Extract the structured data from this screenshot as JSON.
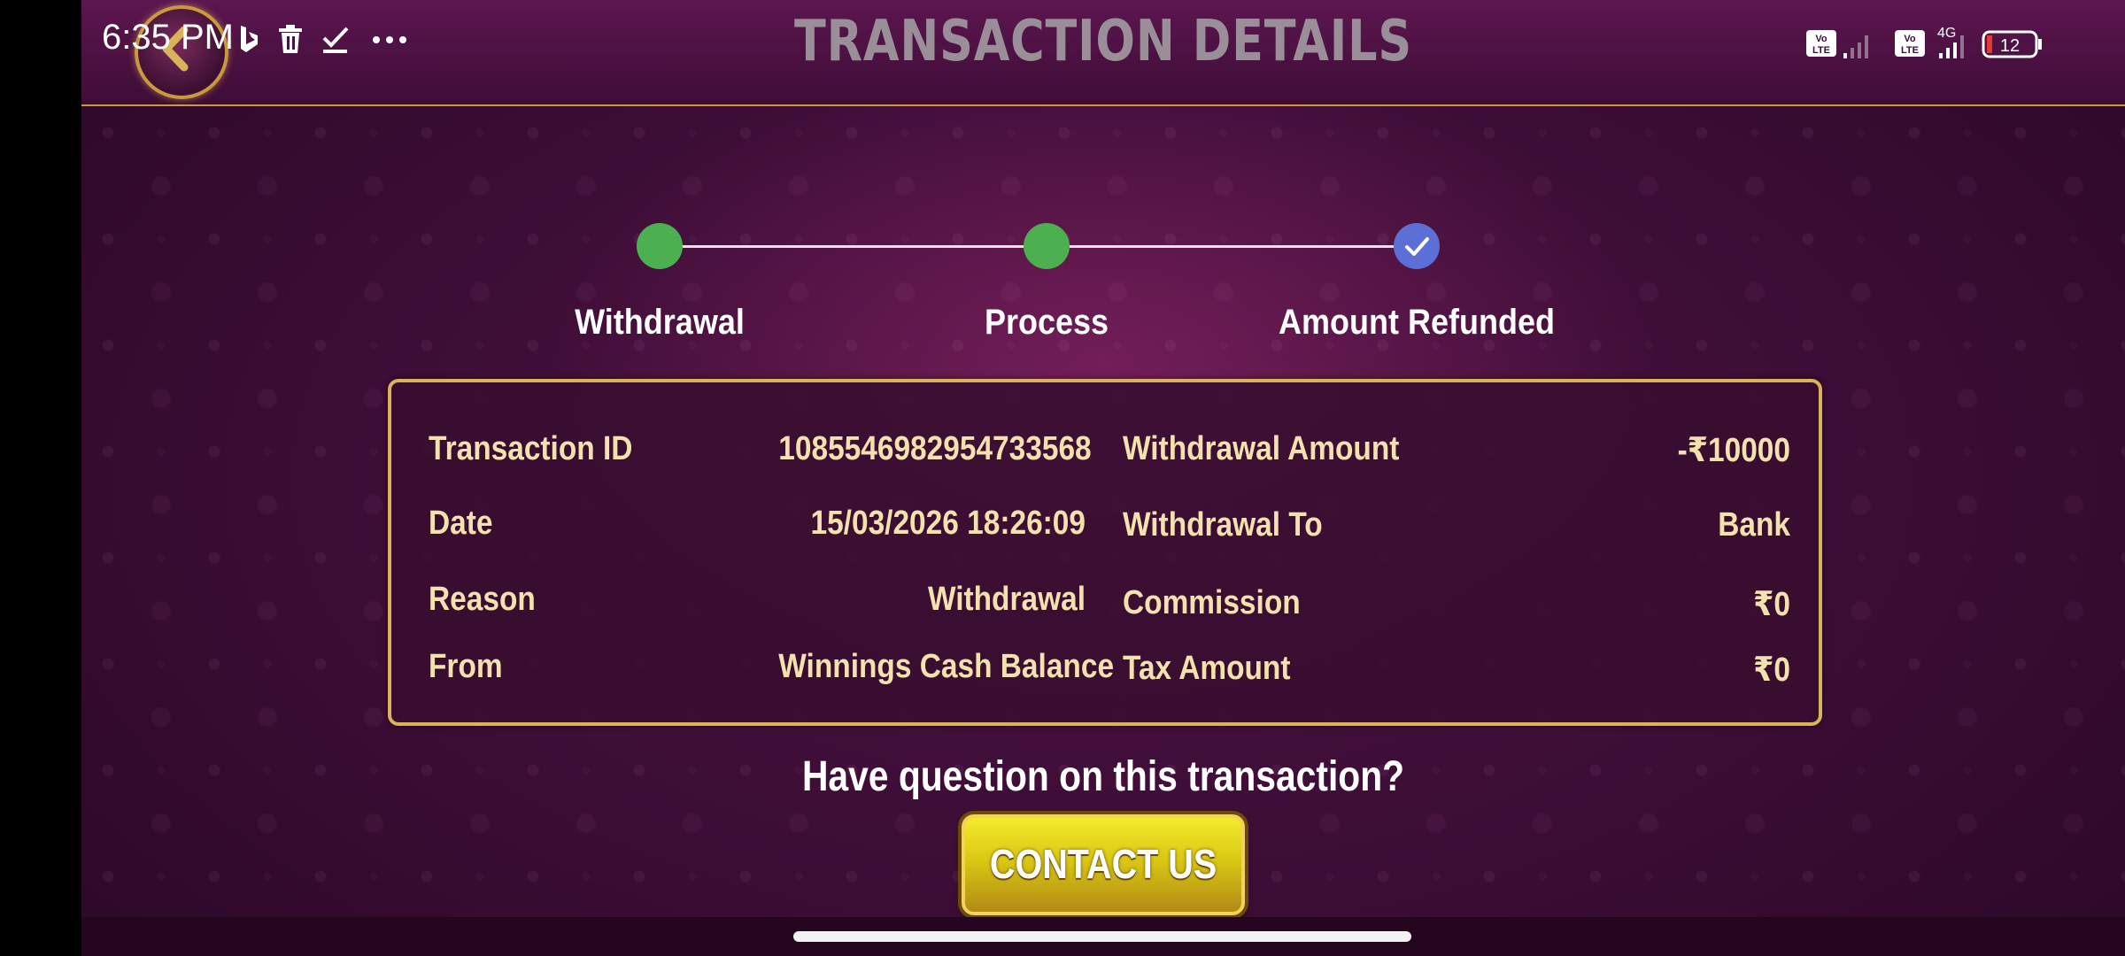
{
  "status_bar": {
    "time": "6:35 PM",
    "left_icons": [
      "bing-icon",
      "trash-icon",
      "check-icon",
      "more-icon"
    ],
    "network": "4G",
    "battery": "12"
  },
  "header": {
    "title": "TRANSACTION DETAILS",
    "back_icon": "back-arrow-icon"
  },
  "stepper": {
    "steps": [
      {
        "label": "Withdrawal",
        "state": "done",
        "color": "#4caf50"
      },
      {
        "label": "Process",
        "state": "done",
        "color": "#4caf50"
      },
      {
        "label": "Amount Refunded",
        "state": "current",
        "color": "#5b6fd6"
      }
    ]
  },
  "details": {
    "left": [
      {
        "label": "Transaction ID",
        "value": "1085546982954733568"
      },
      {
        "label": "Date",
        "value": "15/03/2026 18:26:09"
      },
      {
        "label": "Reason",
        "value": "Withdrawal"
      },
      {
        "label": "From",
        "value": "Winnings Cash Balance"
      }
    ],
    "right": [
      {
        "label": "Withdrawal Amount",
        "value": "-₹10000"
      },
      {
        "label": "Withdrawal To",
        "value": "Bank"
      },
      {
        "label": "Commission",
        "value": "₹0"
      },
      {
        "label": "Tax Amount",
        "value": "₹0"
      }
    ]
  },
  "footer": {
    "question": "Have question on this transaction?",
    "contact_label": "CONTACT US"
  },
  "colors": {
    "background": "#3b0d35",
    "accent_gold": "#d8b35a",
    "detail_text": "#f3e2ae",
    "button_yellow": "#e5d61c"
  }
}
